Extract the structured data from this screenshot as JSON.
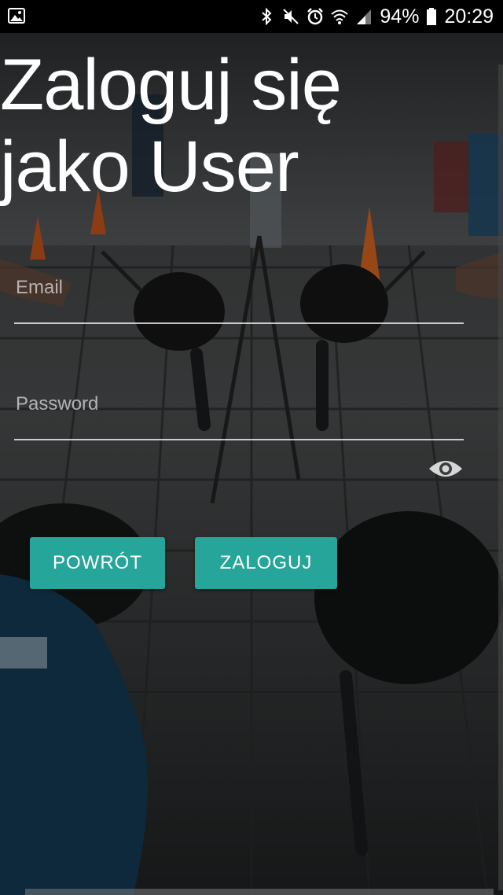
{
  "status_bar": {
    "battery_percent": "94%",
    "time": "20:29",
    "icons": [
      "image-icon",
      "bluetooth-icon",
      "mute-icon",
      "alarm-icon",
      "wifi-icon",
      "signal-icon",
      "battery-icon"
    ]
  },
  "login": {
    "title_line1": "Zaloguj się",
    "title_line2": "jako User",
    "email_placeholder": "Email",
    "password_placeholder": "Password",
    "back_label": "POWRÓT",
    "login_label": "ZALOGUJ"
  },
  "colors": {
    "accent": "#26a69a",
    "status_bar": "#000000",
    "text": "#ffffff"
  }
}
